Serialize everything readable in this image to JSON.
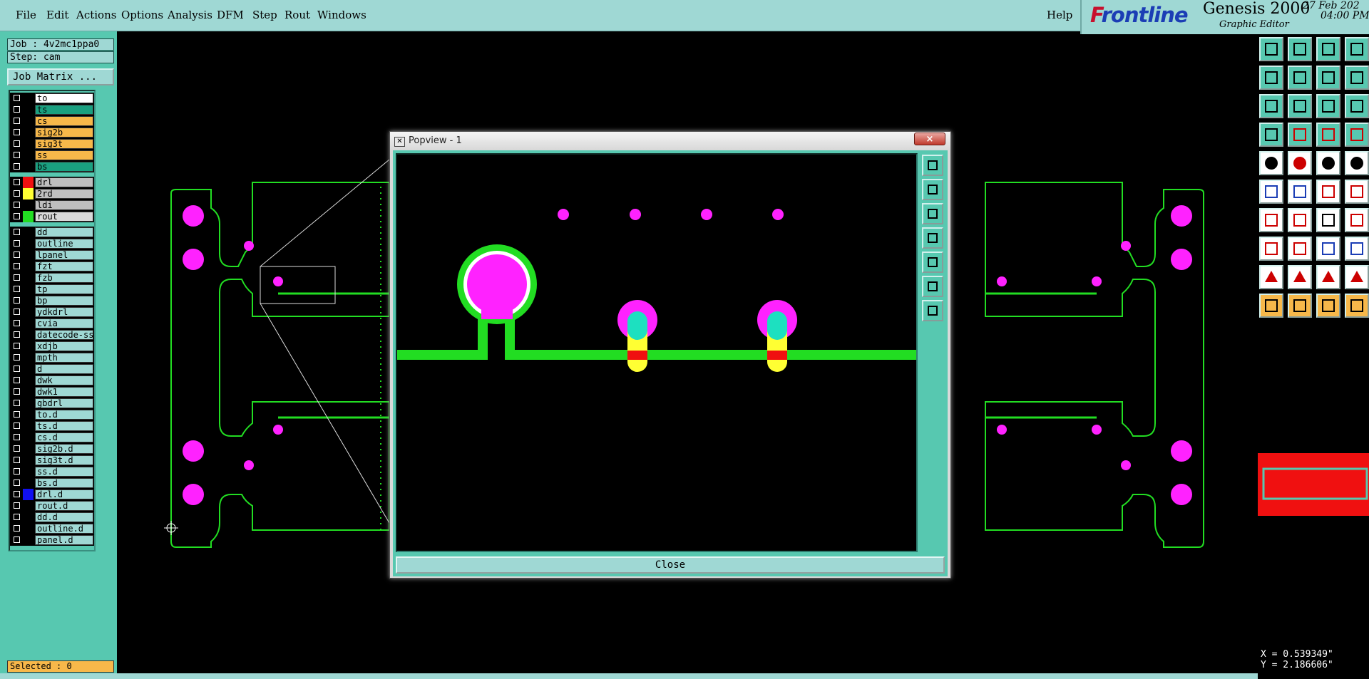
{
  "menu": {
    "items": [
      "File",
      "Edit",
      "Actions",
      "Options",
      "Analysis",
      "DFM",
      "Step",
      "Rout",
      "Windows"
    ],
    "help": "Help"
  },
  "brand": {
    "logo": "Frontline",
    "title": "Genesis 2000",
    "subtitle": "Graphic Editor",
    "date": "27 Feb 202",
    "time": "04:00 PM"
  },
  "job": {
    "job": "Job : 4v2mc1ppa0",
    "step": "Step: cam",
    "matrix_button": "Job Matrix ..."
  },
  "layers": [
    {
      "name": "to",
      "bg": "#ffffff",
      "color": "#000000"
    },
    {
      "name": "ts",
      "bg": "#1aa080",
      "color": "#000000"
    },
    {
      "name": "cs",
      "bg": "#f7b84a",
      "color": "#000000"
    },
    {
      "name": "sig2b",
      "bg": "#f7b84a",
      "color": "#000000"
    },
    {
      "name": "sig3t",
      "bg": "#f7b84a",
      "color": "#000000"
    },
    {
      "name": "ss",
      "bg": "#f7b84a",
      "color": "#000000"
    },
    {
      "name": "bs",
      "bg": "#1aa080",
      "color": "#000000"
    },
    {
      "name": "drl",
      "bg": "#bfbfbf",
      "color": "#f01010"
    },
    {
      "name": "2rd",
      "bg": "#bfbfbf",
      "color": "#ffff33"
    },
    {
      "name": "ldi",
      "bg": "#bfbfbf",
      "color": "#000000"
    },
    {
      "name": "rout",
      "bg": "#d9d9d9",
      "color": "#22dd22"
    },
    {
      "name": "dd",
      "bg": "#9fd8d4",
      "color": "#000000"
    },
    {
      "name": "outline",
      "bg": "#9fd8d4",
      "color": "#000000"
    },
    {
      "name": "lpanel",
      "bg": "#9fd8d4",
      "color": "#000000"
    },
    {
      "name": "fzt",
      "bg": "#9fd8d4",
      "color": "#000000"
    },
    {
      "name": "fzb",
      "bg": "#9fd8d4",
      "color": "#000000"
    },
    {
      "name": "tp",
      "bg": "#9fd8d4",
      "color": "#000000"
    },
    {
      "name": "bp",
      "bg": "#9fd8d4",
      "color": "#000000"
    },
    {
      "name": "ydkdrl",
      "bg": "#9fd8d4",
      "color": "#000000"
    },
    {
      "name": "cvia",
      "bg": "#9fd8d4",
      "color": "#000000"
    },
    {
      "name": "datecode-ss",
      "bg": "#9fd8d4",
      "color": "#000000"
    },
    {
      "name": "xdjb",
      "bg": "#9fd8d4",
      "color": "#000000"
    },
    {
      "name": "mpth",
      "bg": "#9fd8d4",
      "color": "#000000"
    },
    {
      "name": "d",
      "bg": "#9fd8d4",
      "color": "#000000"
    },
    {
      "name": "dwk",
      "bg": "#9fd8d4",
      "color": "#000000"
    },
    {
      "name": "dwk1",
      "bg": "#9fd8d4",
      "color": "#000000"
    },
    {
      "name": "gbdrl",
      "bg": "#9fd8d4",
      "color": "#000000"
    },
    {
      "name": "to.d",
      "bg": "#9fd8d4",
      "color": "#000000"
    },
    {
      "name": "ts.d",
      "bg": "#9fd8d4",
      "color": "#000000"
    },
    {
      "name": "cs.d",
      "bg": "#9fd8d4",
      "color": "#000000"
    },
    {
      "name": "sig2b.d",
      "bg": "#9fd8d4",
      "color": "#000000"
    },
    {
      "name": "sig3t.d",
      "bg": "#9fd8d4",
      "color": "#000000"
    },
    {
      "name": "ss.d",
      "bg": "#9fd8d4",
      "color": "#000000"
    },
    {
      "name": "bs.d",
      "bg": "#9fd8d4",
      "color": "#000000"
    },
    {
      "name": "drl.d",
      "bg": "#9fd8d4",
      "color": "#1010f0"
    },
    {
      "name": "rout.d",
      "bg": "#9fd8d4",
      "color": "#000000"
    },
    {
      "name": "dd.d",
      "bg": "#9fd8d4",
      "color": "#000000"
    },
    {
      "name": "outline.d",
      "bg": "#9fd8d4",
      "color": "#000000"
    },
    {
      "name": "panel.d",
      "bg": "#9fd8d4",
      "color": "#000000"
    }
  ],
  "status": {
    "selected": "Selected : 0"
  },
  "popup": {
    "title": "Popview - 1",
    "close_x": "×",
    "close_button": "Close"
  },
  "coords": {
    "x": "X = 0.539349\"",
    "y": "Y = 2.186606\""
  },
  "colors": {
    "panel": "#57c8b0",
    "menubar": "#9fd8d4",
    "rout": "#22dd22",
    "pad": "#ff22ff",
    "accent": "#f7b84a"
  }
}
